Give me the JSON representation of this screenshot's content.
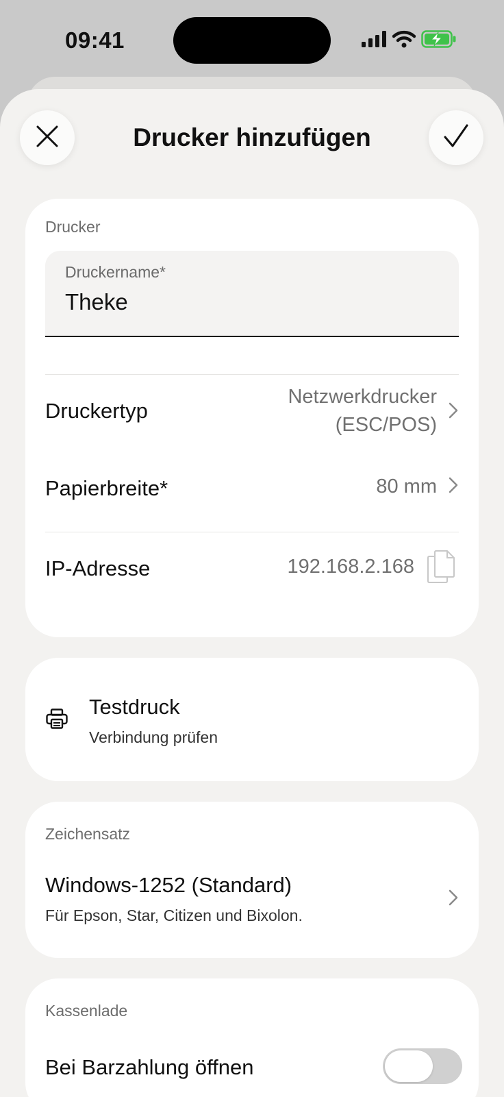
{
  "status_bar": {
    "time": "09:41",
    "icons": [
      "signal-icon",
      "wifi-icon",
      "battery-charging-icon"
    ],
    "battery_color": "#3fc24a"
  },
  "header": {
    "title": "Drucker hinzufügen",
    "close_icon": "close-icon",
    "confirm_icon": "checkmark-icon"
  },
  "printer": {
    "section_label": "Drucker",
    "name_field": {
      "label": "Druckername*",
      "value": "Theke"
    },
    "printer_type": {
      "label": "Druckertyp",
      "value_line1": "Netzwerkdrucker",
      "value_line2": "(ESC/POS)"
    },
    "paper_width": {
      "label": "Papierbreite*",
      "value": "80 mm"
    },
    "ip_address": {
      "label": "IP-Adresse",
      "value": "192.168.2.168",
      "icon": "copy-icon"
    }
  },
  "test_print": {
    "icon": "printer-icon",
    "title": "Testdruck",
    "subtitle": "Verbindung prüfen"
  },
  "charset": {
    "section_label": "Zeichensatz",
    "title": "Windows-1252 (Standard)",
    "subtitle": "Für Epson, Star, Citizen und Bixolon."
  },
  "cash_drawer": {
    "section_label": "Kassenlade",
    "open_on_cash": {
      "label": "Bei Barzahlung öffnen",
      "enabled": false
    }
  }
}
